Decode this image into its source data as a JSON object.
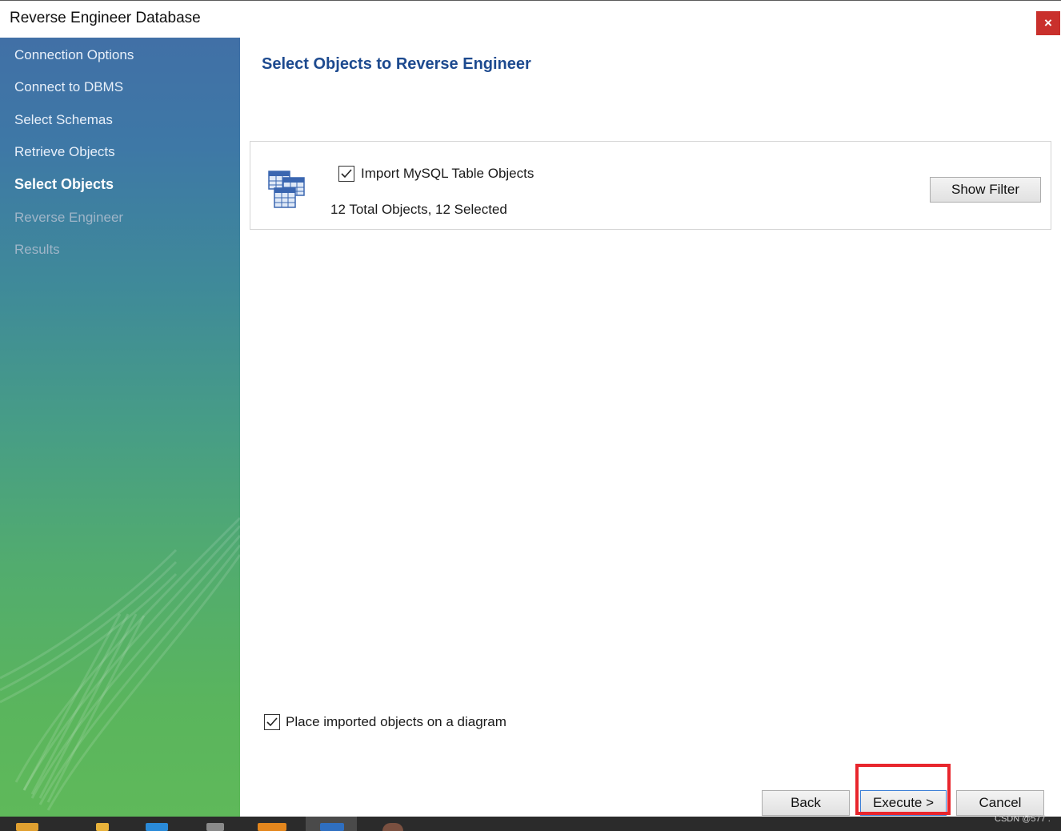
{
  "window": {
    "title": "Reverse Engineer Database",
    "close_label": "×"
  },
  "sidebar": {
    "steps": [
      {
        "label": "Connection Options",
        "state": "done"
      },
      {
        "label": "Connect to DBMS",
        "state": "done"
      },
      {
        "label": "Select Schemas",
        "state": "done"
      },
      {
        "label": "Retrieve Objects",
        "state": "done"
      },
      {
        "label": "Select Objects",
        "state": "active"
      },
      {
        "label": "Reverse Engineer",
        "state": "pending"
      },
      {
        "label": "Results",
        "state": "pending"
      }
    ]
  },
  "main": {
    "heading": "Select Objects to Reverse Engineer",
    "import_panel": {
      "checkbox_label": "Import MySQL Table Objects",
      "checked": true,
      "count_text": "12 Total Objects, 12 Selected",
      "filter_button": "Show Filter",
      "icon": "database-tables-icon"
    },
    "place_on_diagram": {
      "label": "Place imported objects on a diagram",
      "checked": true
    }
  },
  "footer": {
    "back_button": "Back",
    "execute_button": "Execute >",
    "cancel_button": "Cancel"
  },
  "watermark": "CSDN @577 .",
  "colors": {
    "heading": "#1d4a8f",
    "highlight": "#e8262d",
    "close": "#c9302c"
  }
}
